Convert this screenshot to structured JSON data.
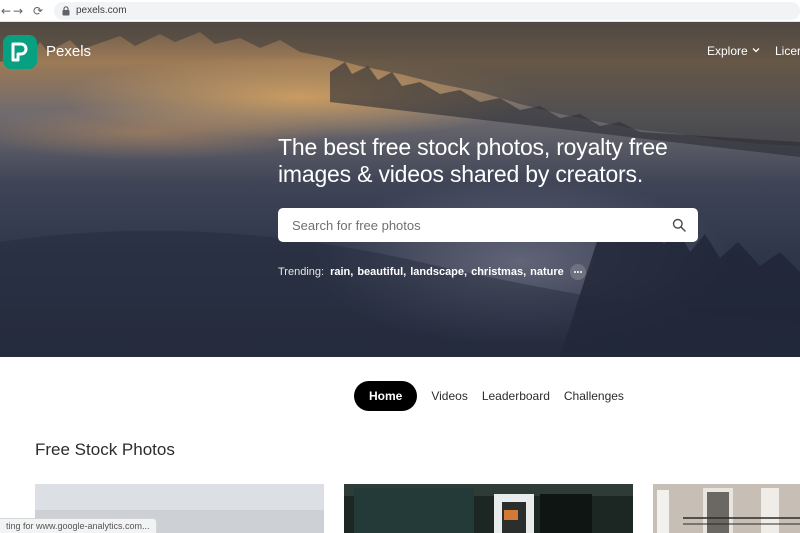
{
  "browser": {
    "url": "pexels.com"
  },
  "header": {
    "brand": "Pexels",
    "nav": {
      "explore": "Explore",
      "license": "Licer"
    }
  },
  "hero": {
    "headline_line1": "The best free stock photos, royalty free",
    "headline_line2": "images & videos shared by creators.",
    "search": {
      "placeholder": "Search for free photos"
    },
    "trending": {
      "label": "Trending:",
      "items": [
        "rain",
        "beautiful",
        "landscape",
        "christmas",
        "nature"
      ]
    }
  },
  "tabs": {
    "home": "Home",
    "videos": "Videos",
    "leaderboard": "Leaderboard",
    "challenges": "Challenges"
  },
  "main": {
    "section_title": "Free Stock Photos"
  },
  "status_bar": {
    "text": "ting for www.google-analytics.com..."
  },
  "colors": {
    "brand_green": "#07a081",
    "active_tab": "#000000"
  },
  "icons": [
    "back-arrow-icon",
    "forward-arrow-icon",
    "reload-icon",
    "lock-icon",
    "pexels-logo-icon",
    "chevron-down-icon",
    "search-icon",
    "more-dots-icon"
  ]
}
